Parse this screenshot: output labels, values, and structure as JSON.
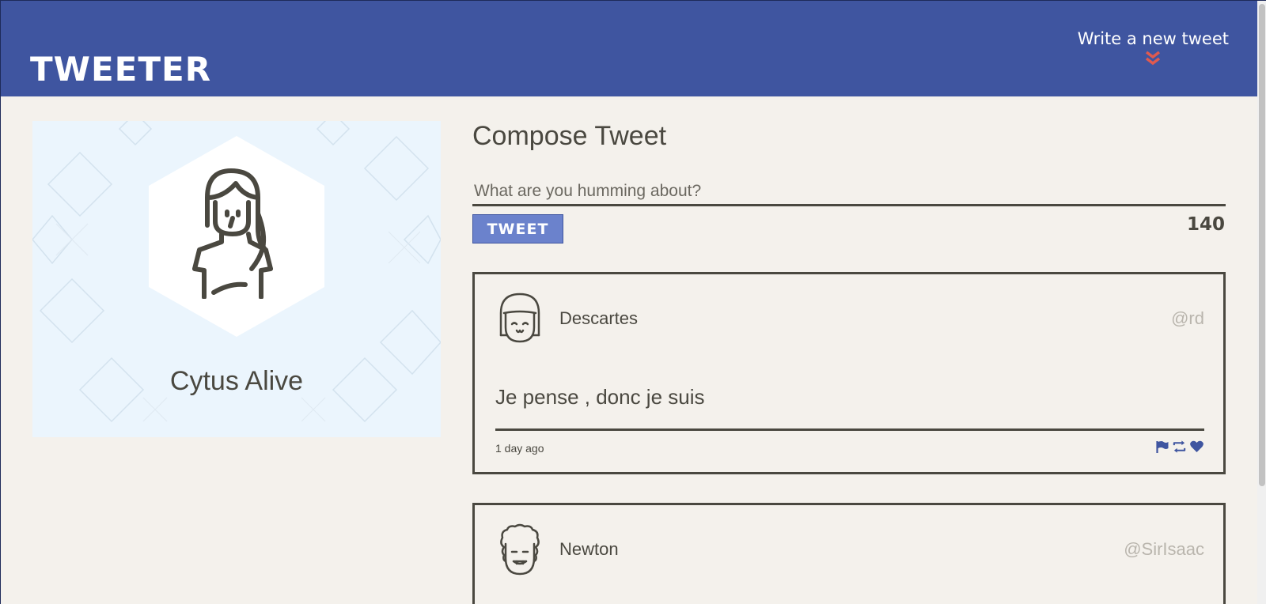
{
  "header": {
    "logo": "TWEETER",
    "compose_link_strong": "Write",
    "compose_link_rest": " a new tweet"
  },
  "profile": {
    "name": "Cytus Alive"
  },
  "compose": {
    "title": "Compose Tweet",
    "placeholder": "What are you humming about?",
    "button_label": "TWEET",
    "counter": "140"
  },
  "tweets": [
    {
      "name": "Descartes",
      "handle": "@rd",
      "body": "Je pense , donc je suis",
      "time": "1 day ago"
    },
    {
      "name": "Newton",
      "handle": "@SirIsaac"
    }
  ],
  "colors": {
    "header": "#3f55a0",
    "page_bg": "#f4f1ec",
    "text": "#4a4840",
    "accent_chevron": "#e05a4f",
    "button": "#6b82cc",
    "profile_bg": "#ebf5fd"
  },
  "icons": [
    "chevron-double-down-icon",
    "flag-icon",
    "retweet-icon",
    "heart-icon"
  ]
}
